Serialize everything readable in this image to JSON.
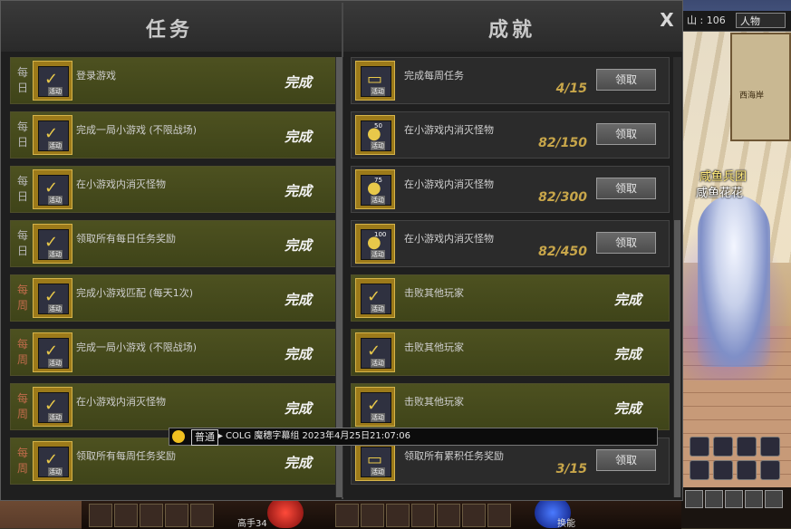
{
  "window": {
    "left_title": "任务",
    "right_title": "成就",
    "close_glyph": "X"
  },
  "tasks": [
    {
      "period": "每日",
      "kind": "daily",
      "name": "登录游戏",
      "status": "完成",
      "icon": "calendar-check-icon"
    },
    {
      "period": "每日",
      "kind": "daily",
      "name": "完成一局小游戏 (不限战场)",
      "status": "完成",
      "icon": "checkmark-icon"
    },
    {
      "period": "每日",
      "kind": "daily",
      "name": "在小游戏内消灭怪物",
      "status": "完成",
      "icon": "checkmark-icon"
    },
    {
      "period": "每日",
      "kind": "daily",
      "name": "领取所有每日任务奖励",
      "status": "完成",
      "icon": "checkmark-icon"
    },
    {
      "period": "每周",
      "kind": "weekly",
      "name": "完成小游戏匹配 (每天1次)",
      "status": "完成",
      "icon": "checkmark-icon"
    },
    {
      "period": "每周",
      "kind": "weekly",
      "name": "完成一局小游戏 (不限战场)",
      "status": "完成",
      "icon": "checkmark-icon"
    },
    {
      "period": "每周",
      "kind": "weekly",
      "name": "在小游戏内消灭怪物",
      "status": "完成",
      "icon": "checkmark-icon"
    },
    {
      "period": "每周",
      "kind": "weekly",
      "name": "领取所有每周任务奖励",
      "status": "完成",
      "icon": "checkmark-icon"
    }
  ],
  "achievements": [
    {
      "name": "完成每周任务",
      "progress": "4/15",
      "button": "领取",
      "icon": "chest-icon",
      "badge": ""
    },
    {
      "name": "在小游戏内消灭怪物",
      "progress": "82/150",
      "button": "领取",
      "icon": "coin-icon",
      "badge": "50"
    },
    {
      "name": "在小游戏内消灭怪物",
      "progress": "82/300",
      "button": "领取",
      "icon": "coin-icon",
      "badge": "75"
    },
    {
      "name": "在小游戏内消灭怪物",
      "progress": "82/450",
      "button": "领取",
      "icon": "coin-icon",
      "badge": "100"
    },
    {
      "name": "击败其他玩家",
      "status": "完成",
      "icon": "checkmark-icon"
    },
    {
      "name": "击败其他玩家",
      "status": "完成",
      "icon": "checkmark-icon"
    },
    {
      "name": "击败其他玩家",
      "status": "完成",
      "icon": "checkmark-icon"
    },
    {
      "name": "领取所有累积任务奖励",
      "progress": "3/15",
      "button": "领取",
      "icon": "chest-icon",
      "badge": ""
    }
  ],
  "icon_sub_label": "活动",
  "chat": {
    "channel": "普通",
    "message": "COLG 魔穗字幕组 2023年4月25日21:07:06"
  },
  "hud": {
    "coords": "山 : 106",
    "character_tab": "人物",
    "minimap_label": "西海岸",
    "guild": "咸鱼兵团",
    "character_name": "咸鱼花花",
    "level_label": "高手34",
    "switch_label": "换能"
  },
  "colors": {
    "done_row": "#4d5120",
    "weekly_tag": "#c06b4b",
    "progress_text": "#c8a64a"
  }
}
